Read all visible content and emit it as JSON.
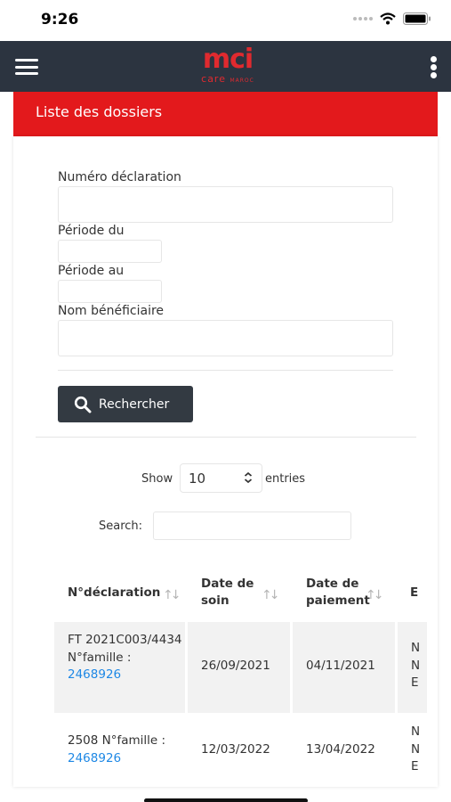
{
  "status_bar": {
    "time": "9:26"
  },
  "brand": {
    "name": "mci",
    "sub": "care",
    "country": "MAROC"
  },
  "page": {
    "title": "Liste des dossiers"
  },
  "form": {
    "numero_label": "Numéro déclaration",
    "periode_du_label": "Période du",
    "periode_au_label": "Période au",
    "nom_label": "Nom bénéficiaire",
    "search_button": "Rechercher"
  },
  "table_controls": {
    "show_label": "Show",
    "entries_value": "10",
    "entries_label": "entries",
    "search_label": "Search:"
  },
  "table": {
    "headers": [
      "N°déclaration",
      "Date de soin",
      "Date de paiement",
      "E"
    ],
    "rows": [
      {
        "declaration": "FT 2021C003/4434 N°famille :",
        "famille": "2468926",
        "date_soin": "26/09/2021",
        "date_paiement": "04/11/2021",
        "col4": "N N E"
      },
      {
        "declaration": "2508 N°famille :",
        "famille": "2468926",
        "date_soin": "12/03/2022",
        "date_paiement": "13/04/2022",
        "col4": "N N E"
      }
    ]
  },
  "colors": {
    "navbar": "#2c3440",
    "accent_red": "#e3191c",
    "link_blue": "#1e88e5",
    "button_dark": "#333a42"
  },
  "icons": [
    "menu-icon",
    "more-vertical-icon",
    "search-icon",
    "wifi-icon",
    "battery-icon",
    "sort-icon",
    "select-chevrons-icon"
  ]
}
